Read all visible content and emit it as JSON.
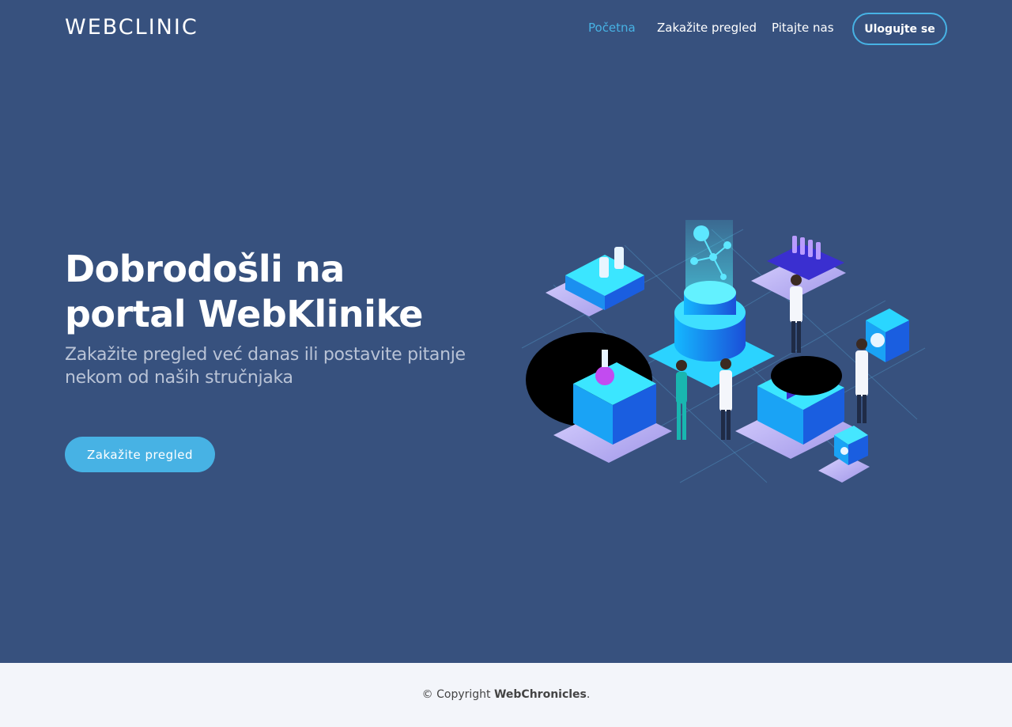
{
  "header": {
    "logo": "WEBCLINIC",
    "nav": [
      {
        "label": "Početna",
        "active": true
      },
      {
        "label": "Zakažite pregled",
        "active": false
      },
      {
        "label": "Pitajte nas",
        "active": false
      }
    ],
    "login_label": "Ulogujte se"
  },
  "hero": {
    "title": "Dobrodošli na portal WebKlinike",
    "subtitle": "Zakažite pregled već danas ili postavite pitanje nekom od naših stručnjaka",
    "cta_label": "Zakažite pregled",
    "illustration": "isometric-medical-lab-illustration"
  },
  "footer": {
    "copyright_prefix": "© Copyright",
    "copyright_brand": "WebChronicles",
    "copyright_suffix": "."
  },
  "colors": {
    "background": "#37517e",
    "accent": "#47b2e4",
    "footer_bg": "#f3f5fa",
    "subtitle_text": "#b9c3d6"
  }
}
